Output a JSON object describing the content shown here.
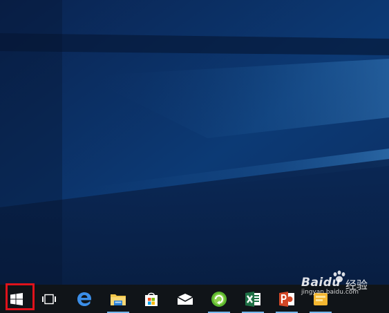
{
  "desktop": {
    "background_colors": {
      "base": "#0a2a57",
      "light_beam": "#2f74b5",
      "dark": "#061733"
    }
  },
  "taskbar": {
    "background": "#101418",
    "accent": "#76b9ed",
    "highlight_color": "#e0121b",
    "items": [
      {
        "name": "start-button",
        "icon": "windows-logo-icon",
        "highlighted": true
      },
      {
        "name": "task-view-button",
        "icon": "task-view-icon"
      },
      {
        "name": "edge-button",
        "icon": "edge-browser-icon"
      },
      {
        "name": "file-explorer-button",
        "icon": "folder-icon",
        "active": true
      },
      {
        "name": "store-button",
        "icon": "store-bag-icon"
      },
      {
        "name": "mail-button",
        "icon": "mail-envelope-icon"
      },
      {
        "name": "green-app-button",
        "icon": "green-refresh-icon",
        "active": true
      },
      {
        "name": "excel-button",
        "icon": "excel-icon",
        "active": true
      },
      {
        "name": "powerpoint-button",
        "icon": "powerpoint-icon",
        "active": true
      },
      {
        "name": "yellow-app-button",
        "icon": "yellow-app-icon",
        "active": true
      }
    ]
  },
  "watermark": {
    "logo": "Baidu",
    "cn_text": "经验",
    "url": "jingyan.baidu.com"
  }
}
